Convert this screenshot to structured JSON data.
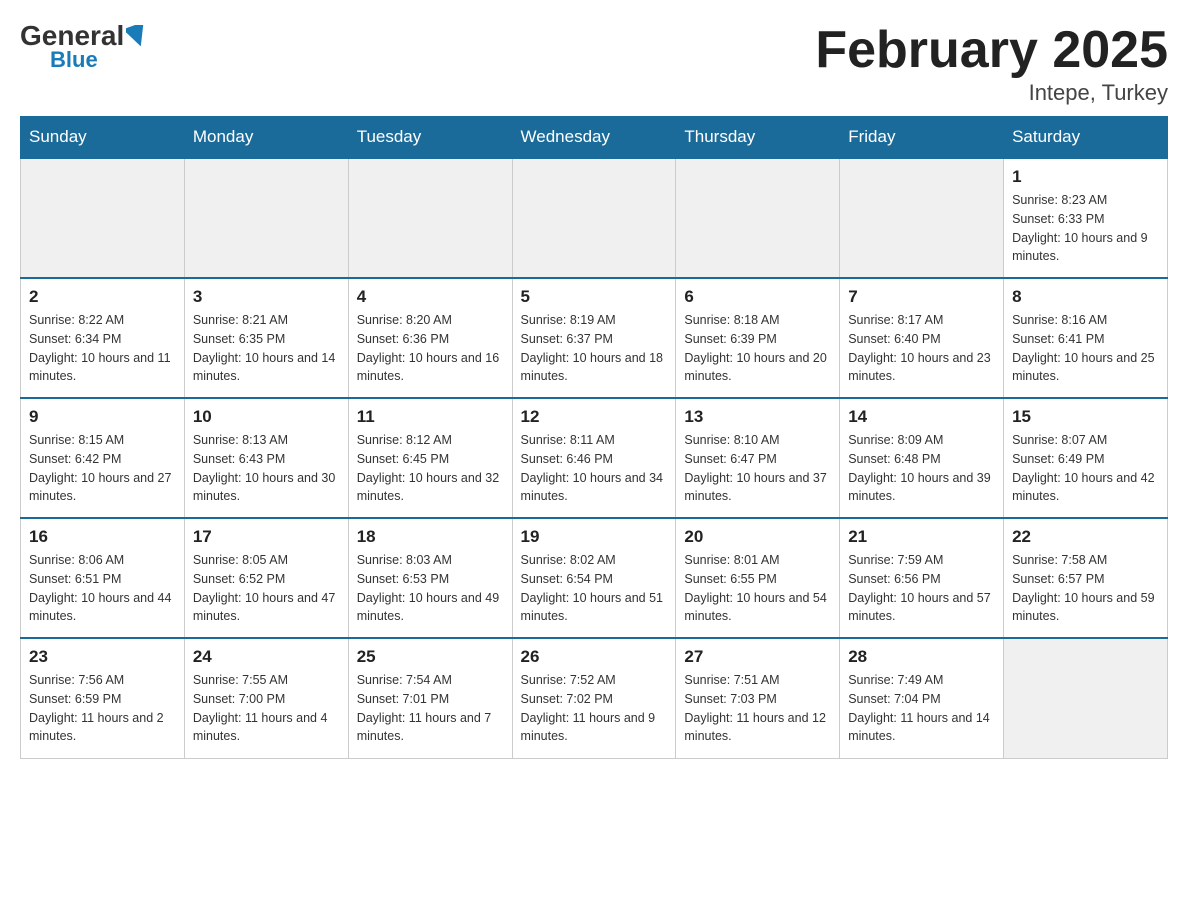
{
  "header": {
    "logo_general": "General",
    "logo_blue": "Blue",
    "month_title": "February 2025",
    "location": "Intepe, Turkey"
  },
  "days_of_week": [
    "Sunday",
    "Monday",
    "Tuesday",
    "Wednesday",
    "Thursday",
    "Friday",
    "Saturday"
  ],
  "weeks": [
    [
      {
        "day": "",
        "info": ""
      },
      {
        "day": "",
        "info": ""
      },
      {
        "day": "",
        "info": ""
      },
      {
        "day": "",
        "info": ""
      },
      {
        "day": "",
        "info": ""
      },
      {
        "day": "",
        "info": ""
      },
      {
        "day": "1",
        "info": "Sunrise: 8:23 AM\nSunset: 6:33 PM\nDaylight: 10 hours and 9 minutes."
      }
    ],
    [
      {
        "day": "2",
        "info": "Sunrise: 8:22 AM\nSunset: 6:34 PM\nDaylight: 10 hours and 11 minutes."
      },
      {
        "day": "3",
        "info": "Sunrise: 8:21 AM\nSunset: 6:35 PM\nDaylight: 10 hours and 14 minutes."
      },
      {
        "day": "4",
        "info": "Sunrise: 8:20 AM\nSunset: 6:36 PM\nDaylight: 10 hours and 16 minutes."
      },
      {
        "day": "5",
        "info": "Sunrise: 8:19 AM\nSunset: 6:37 PM\nDaylight: 10 hours and 18 minutes."
      },
      {
        "day": "6",
        "info": "Sunrise: 8:18 AM\nSunset: 6:39 PM\nDaylight: 10 hours and 20 minutes."
      },
      {
        "day": "7",
        "info": "Sunrise: 8:17 AM\nSunset: 6:40 PM\nDaylight: 10 hours and 23 minutes."
      },
      {
        "day": "8",
        "info": "Sunrise: 8:16 AM\nSunset: 6:41 PM\nDaylight: 10 hours and 25 minutes."
      }
    ],
    [
      {
        "day": "9",
        "info": "Sunrise: 8:15 AM\nSunset: 6:42 PM\nDaylight: 10 hours and 27 minutes."
      },
      {
        "day": "10",
        "info": "Sunrise: 8:13 AM\nSunset: 6:43 PM\nDaylight: 10 hours and 30 minutes."
      },
      {
        "day": "11",
        "info": "Sunrise: 8:12 AM\nSunset: 6:45 PM\nDaylight: 10 hours and 32 minutes."
      },
      {
        "day": "12",
        "info": "Sunrise: 8:11 AM\nSunset: 6:46 PM\nDaylight: 10 hours and 34 minutes."
      },
      {
        "day": "13",
        "info": "Sunrise: 8:10 AM\nSunset: 6:47 PM\nDaylight: 10 hours and 37 minutes."
      },
      {
        "day": "14",
        "info": "Sunrise: 8:09 AM\nSunset: 6:48 PM\nDaylight: 10 hours and 39 minutes."
      },
      {
        "day": "15",
        "info": "Sunrise: 8:07 AM\nSunset: 6:49 PM\nDaylight: 10 hours and 42 minutes."
      }
    ],
    [
      {
        "day": "16",
        "info": "Sunrise: 8:06 AM\nSunset: 6:51 PM\nDaylight: 10 hours and 44 minutes."
      },
      {
        "day": "17",
        "info": "Sunrise: 8:05 AM\nSunset: 6:52 PM\nDaylight: 10 hours and 47 minutes."
      },
      {
        "day": "18",
        "info": "Sunrise: 8:03 AM\nSunset: 6:53 PM\nDaylight: 10 hours and 49 minutes."
      },
      {
        "day": "19",
        "info": "Sunrise: 8:02 AM\nSunset: 6:54 PM\nDaylight: 10 hours and 51 minutes."
      },
      {
        "day": "20",
        "info": "Sunrise: 8:01 AM\nSunset: 6:55 PM\nDaylight: 10 hours and 54 minutes."
      },
      {
        "day": "21",
        "info": "Sunrise: 7:59 AM\nSunset: 6:56 PM\nDaylight: 10 hours and 57 minutes."
      },
      {
        "day": "22",
        "info": "Sunrise: 7:58 AM\nSunset: 6:57 PM\nDaylight: 10 hours and 59 minutes."
      }
    ],
    [
      {
        "day": "23",
        "info": "Sunrise: 7:56 AM\nSunset: 6:59 PM\nDaylight: 11 hours and 2 minutes."
      },
      {
        "day": "24",
        "info": "Sunrise: 7:55 AM\nSunset: 7:00 PM\nDaylight: 11 hours and 4 minutes."
      },
      {
        "day": "25",
        "info": "Sunrise: 7:54 AM\nSunset: 7:01 PM\nDaylight: 11 hours and 7 minutes."
      },
      {
        "day": "26",
        "info": "Sunrise: 7:52 AM\nSunset: 7:02 PM\nDaylight: 11 hours and 9 minutes."
      },
      {
        "day": "27",
        "info": "Sunrise: 7:51 AM\nSunset: 7:03 PM\nDaylight: 11 hours and 12 minutes."
      },
      {
        "day": "28",
        "info": "Sunrise: 7:49 AM\nSunset: 7:04 PM\nDaylight: 11 hours and 14 minutes."
      },
      {
        "day": "",
        "info": ""
      }
    ]
  ]
}
